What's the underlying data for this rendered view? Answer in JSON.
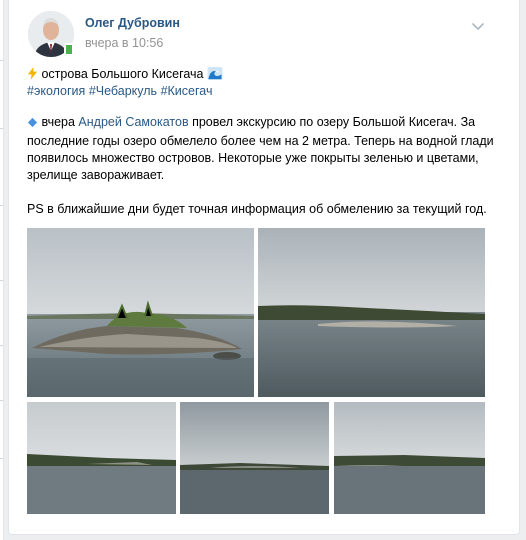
{
  "post": {
    "author": "Олег Дубровин",
    "time": "вчера в 10:56",
    "title": "острова Большого Кисегача",
    "hashtags": [
      "#экология",
      "#Чебаркуль",
      "#Кисегач"
    ],
    "body_prefix": "вчера",
    "body_link": "Андрей Самокатов",
    "body_rest_1": "провел экскурсию по озеру Большой Кисегач. За",
    "body_line_2": "последние годы озеро обмелело более чем на 2 метра. Теперь на водной глади",
    "body_line_3": "появилось множество островов. Некоторые уже покрыты зеленью и цветами,",
    "body_line_4": "зрелище завораживает.",
    "ps": "PS в ближайшие дни будет точная информация об обмелению за текущий год."
  },
  "icons": {
    "more": "chevron-down-icon",
    "title_emoji": "lightning-icon",
    "title_emoji_end": "wave-icon",
    "body_bullet": "blue-diamond-icon"
  },
  "colors": {
    "link": "#2a5885",
    "time": "#939393",
    "background": "#edeef0"
  }
}
